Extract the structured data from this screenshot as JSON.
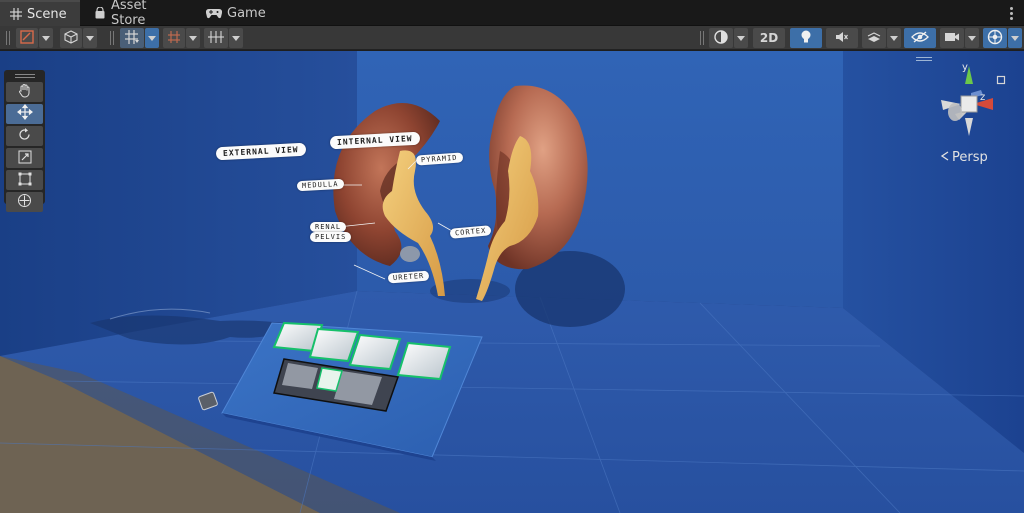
{
  "tabs": [
    {
      "label": "Scene",
      "icon": "grid-icon",
      "active": true
    },
    {
      "label": "Asset Store",
      "icon": "bag-icon",
      "active": false
    },
    {
      "label": "Game",
      "icon": "gamepad-icon",
      "active": false
    }
  ],
  "toolbar": {
    "mode_2d_label": "2D"
  },
  "viewport": {
    "projection_label": "Persp",
    "axis_labels": {
      "y": "y",
      "z": "z"
    },
    "model_labels": {
      "external_view": "EXTERNAL VIEW",
      "internal_view": "INTERNAL VIEW",
      "pyramid": "PYRAMID",
      "medulla": "MEDULLA",
      "renal": "RENAL",
      "pelvis": "PELVIS",
      "cortex": "CORTEX",
      "ureter": "URETER"
    }
  },
  "tools": [
    "hand-tool",
    "move-tool",
    "rotate-tool",
    "scale-tool",
    "rect-tool",
    "transform-tool"
  ],
  "colors": {
    "tab_bg": "#191919",
    "toolbar_bg": "#383838",
    "scene_back_wall": "#2f5fb0",
    "scene_floor": "#2b55a3",
    "ground": "#6f6354",
    "kidney": "#8a3f2c",
    "ureter_tissue": "#e9b85e",
    "selection_blue": "#3d6fa8"
  }
}
